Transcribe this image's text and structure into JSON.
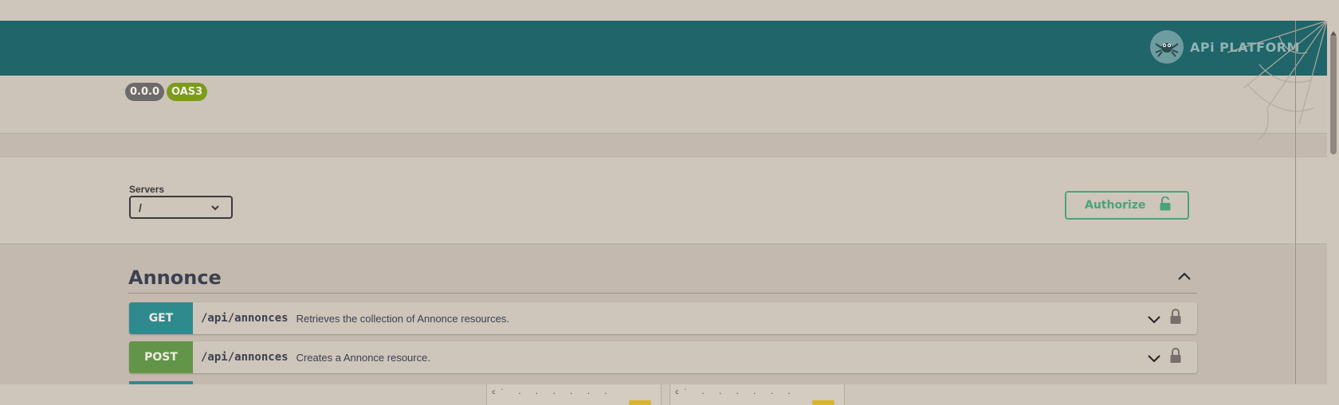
{
  "header": {
    "brand_text": "APi PLATFORM",
    "logo_icon": "spider-logo-icon"
  },
  "info": {
    "version": "0.0.0",
    "spec": "OAS3"
  },
  "servers": {
    "label": "Servers",
    "selected": "/"
  },
  "authorize": {
    "label": "Authorize",
    "icon": "unlocked-lock-icon"
  },
  "tag": {
    "title": "Annonce",
    "toggle_icon": "chevron-up-icon"
  },
  "operations": [
    {
      "method": "GET",
      "path": "/api/annonces",
      "summary": "Retrieves the collection of Annonce resources."
    },
    {
      "method": "POST",
      "path": "/api/annonces",
      "summary": "Creates a Annonce resource."
    }
  ],
  "colors": {
    "header": "#1f6569",
    "get": "#2f8a8e",
    "post": "#629548",
    "authorize": "#49a37c",
    "version_badge": "#6d6a6a",
    "oas_badge": "#7c9b1c"
  }
}
